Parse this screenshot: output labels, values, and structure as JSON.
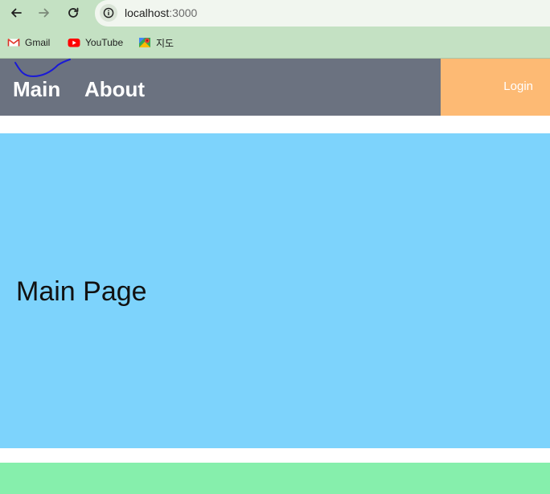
{
  "browser": {
    "url_host": "localhost",
    "url_port": ":3000",
    "bookmarks": [
      {
        "label": "Gmail",
        "icon": "gmail-icon"
      },
      {
        "label": "YouTube",
        "icon": "youtube-icon"
      },
      {
        "label": "지도",
        "icon": "maps-icon"
      }
    ]
  },
  "header": {
    "nav": [
      {
        "label": "Main"
      },
      {
        "label": "About"
      }
    ],
    "login_label": "Login",
    "colors": {
      "header_bg": "#6b7280",
      "login_bg": "#fdba74",
      "scribble": "#1a1ad6"
    }
  },
  "main": {
    "title": "Main Page",
    "bg": "#7dd3fc"
  },
  "footer": {
    "bg": "#86efac"
  }
}
